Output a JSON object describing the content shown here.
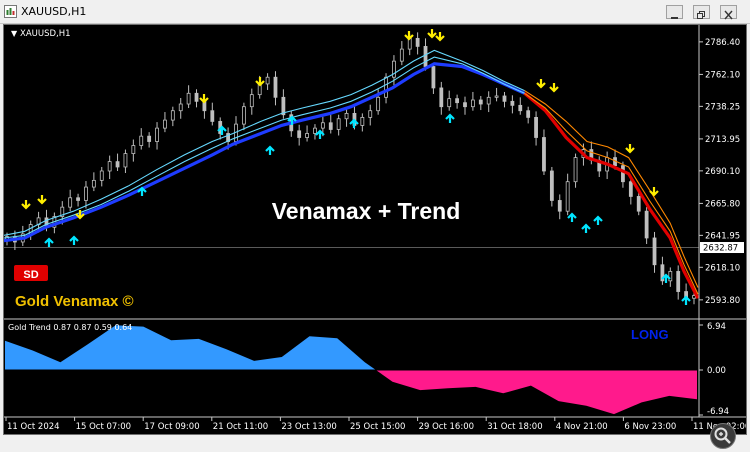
{
  "window": {
    "title": "XAUUSD,H1",
    "buttons": [
      {
        "name": "minimize-button",
        "icon": "minimize-icon"
      },
      {
        "name": "restore-button",
        "icon": "restore-icon"
      },
      {
        "name": "close-button",
        "icon": "close-icon"
      }
    ]
  },
  "chart": {
    "symbol_label": "XAUUSD,H1",
    "watermark": "Venamax + Trend",
    "badge": "SD",
    "badge_color": "#e00000",
    "brand": "Gold Venamax ©",
    "brand_color": "#f0c000",
    "current_price": "2632.87",
    "price_ticks": [
      "2786.40",
      "2762.10",
      "2738.25",
      "2713.95",
      "2690.10",
      "2665.80",
      "2641.95",
      "2618.10",
      "2593.80"
    ],
    "price_range": [
      2581,
      2796
    ],
    "time_labels": [
      "11 Oct 2024",
      "15 Oct 07:00",
      "17 Oct 09:00",
      "21 Oct 11:00",
      "23 Oct 13:00",
      "25 Oct 15:00",
      "29 Oct 16:00",
      "31 Oct 18:00",
      "4 Nov 21:00",
      "6 Nov 23:00",
      "11 Nov 02:00"
    ],
    "colors": {
      "background": "#000000",
      "candle": "#bfbfbf",
      "ma_blue": "#1e3cff",
      "ma_light": "#66d9ff",
      "ma_red": "#e00000",
      "ma_orange": "#ff8800",
      "up_arrow": "#00e5ff",
      "down_arrow": "#ffee00"
    }
  },
  "indicator": {
    "label": "Gold Trend  0.87 0.87 0.59 0.64",
    "signal": "LONG",
    "signal_color": "#0022ee",
    "scale_ticks": [
      "6.94",
      "0.00",
      "-6.94"
    ],
    "scale_range": [
      -6.94,
      6.94
    ],
    "positive_color": "#3399ff",
    "negative_color": "#ff1a8c"
  },
  "chart_data": {
    "type": "line",
    "series": [
      {
        "values": [
          2638,
          2640,
          2648,
          2655,
          2663,
          2672,
          2682,
          2692,
          2702,
          2710,
          2718,
          2724,
          2728,
          2733,
          2738,
          2745,
          2752,
          2762,
          2770,
          2768,
          2762,
          2755,
          2748,
          2735,
          2715,
          2700,
          2695,
          2688,
          2662,
          2640,
          2615,
          2595
        ]
      },
      {
        "values": [
          2640,
          2642,
          2650,
          2657,
          2665,
          2675,
          2686,
          2697,
          2707,
          2714,
          2722,
          2728,
          2732,
          2737,
          2742,
          2749,
          2757,
          2767,
          2775,
          2770,
          2763,
          2755,
          2748,
          2737,
          2720,
          2705,
          2700,
          2693,
          2668,
          2645,
          2620,
          2598
        ]
      },
      {
        "values": [
          2642,
          2645,
          2653,
          2660,
          2669,
          2679,
          2691,
          2702,
          2712,
          2718,
          2727,
          2733,
          2737,
          2742,
          2747,
          2754,
          2762,
          2772,
          2780,
          2772,
          2765,
          2757,
          2750,
          2740,
          2727,
          2712,
          2708,
          2700,
          2676,
          2651,
          2626,
          2603
        ]
      }
    ],
    "xlabel": "",
    "ylabel": "",
    "ylim": [
      2581,
      2796
    ],
    "ma_x_fraction": [
      0,
      0.03,
      0.06,
      0.1,
      0.14,
      0.18,
      0.22,
      0.26,
      0.3,
      0.33,
      0.37,
      0.4,
      0.43,
      0.47,
      0.5,
      0.53,
      0.56,
      0.59,
      0.62,
      0.66,
      0.69,
      0.72,
      0.75,
      0.78,
      0.81,
      0.84,
      0.87,
      0.9,
      0.93,
      0.96,
      0.98,
      1.0
    ],
    "candles": [
      2641,
      2637,
      2643,
      2650,
      2655,
      2648,
      2656,
      2663,
      2670,
      2668,
      2678,
      2683,
      2690,
      2697,
      2693,
      2703,
      2709,
      2716,
      2712,
      2722,
      2728,
      2735,
      2740,
      2748,
      2742,
      2735,
      2727,
      2718,
      2712,
      2725,
      2738,
      2747,
      2755,
      2760,
      2745,
      2732,
      2720,
      2715,
      2718,
      2722,
      2726,
      2721,
      2729,
      2733,
      2724,
      2730,
      2735,
      2745,
      2760,
      2772,
      2781,
      2789,
      2783,
      2768,
      2752,
      2738,
      2744,
      2741,
      2738,
      2743,
      2740,
      2745,
      2746,
      2742,
      2739,
      2735,
      2730,
      2715,
      2690,
      2668,
      2660,
      2682,
      2700,
      2706,
      2698,
      2690,
      2700,
      2694,
      2682,
      2671,
      2660,
      2640,
      2620,
      2608,
      2615,
      2600,
      2595,
      2597
    ],
    "oscillator": {
      "x_fraction": [
        0,
        0.04,
        0.08,
        0.12,
        0.16,
        0.2,
        0.24,
        0.28,
        0.32,
        0.36,
        0.4,
        0.44,
        0.48,
        0.52,
        0.56,
        0.6,
        0.64,
        0.68,
        0.72,
        0.76,
        0.8,
        0.84,
        0.88,
        0.92,
        0.96,
        1.0
      ],
      "values": [
        4.5,
        3.0,
        1.2,
        4.0,
        6.9,
        6.7,
        4.6,
        4.8,
        3.2,
        1.4,
        2.0,
        5.2,
        4.9,
        1.2,
        -1.8,
        -3.1,
        -2.8,
        -2.6,
        -3.6,
        -2.4,
        -4.8,
        -5.5,
        -6.8,
        -5.0,
        -4.0,
        -4.5
      ]
    }
  }
}
